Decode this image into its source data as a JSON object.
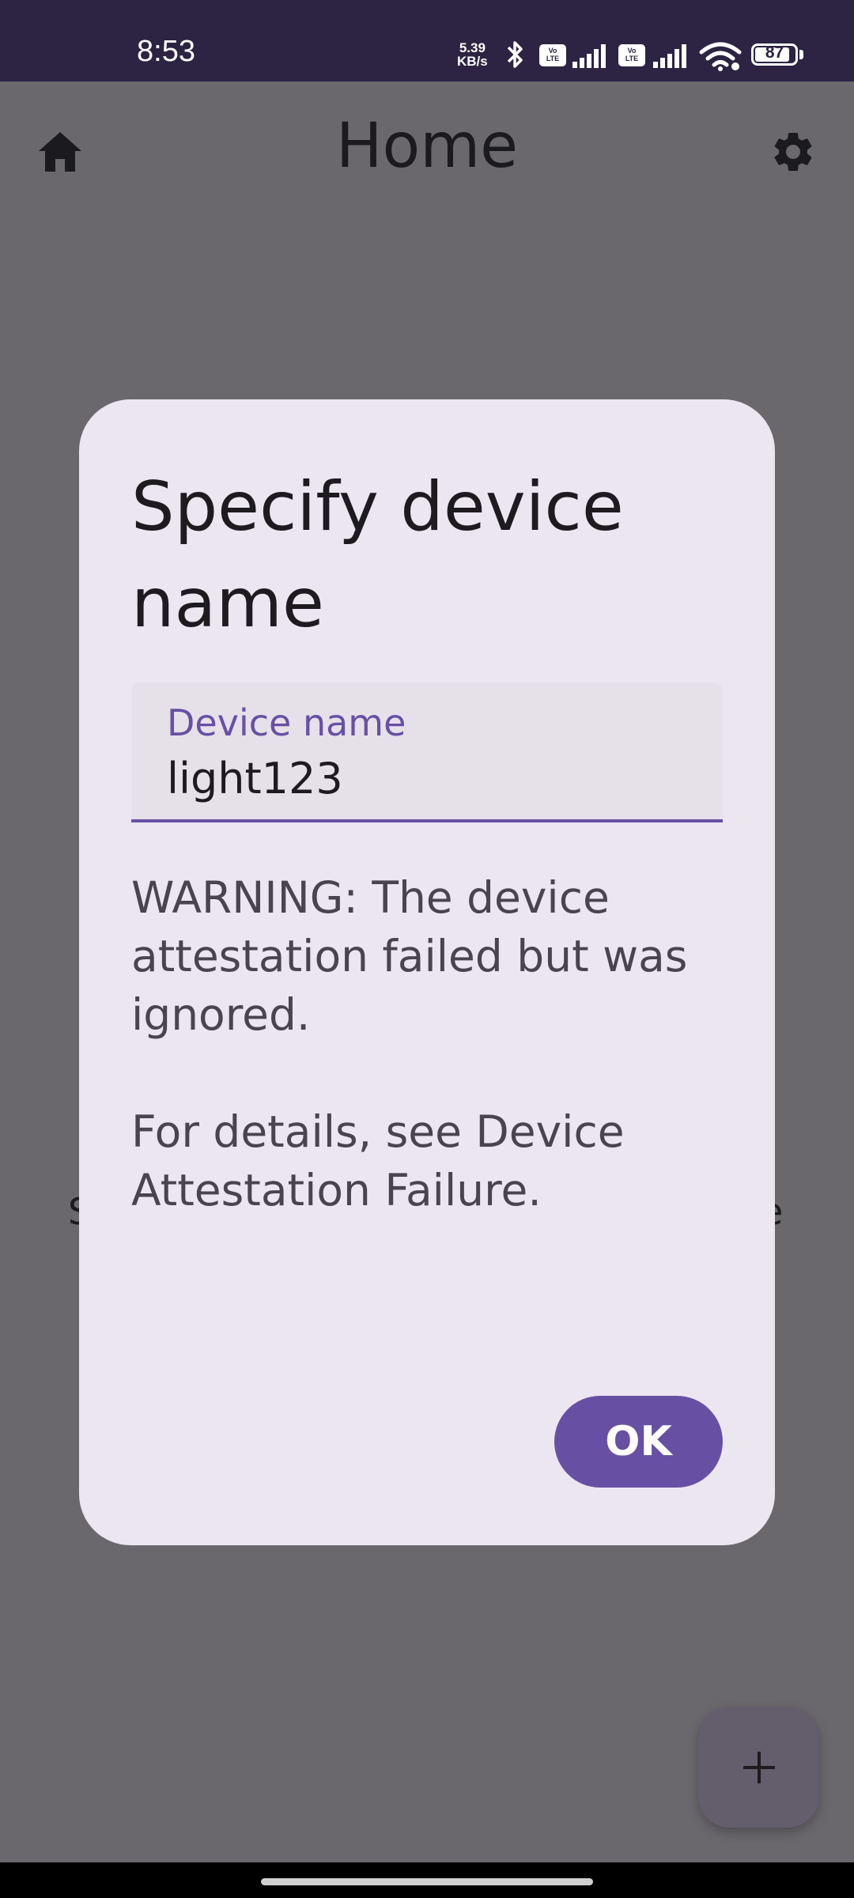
{
  "status_bar": {
    "time": "8:53",
    "net_speed_value": "5.39",
    "net_speed_unit": "KB/s",
    "battery_level": "87",
    "icons": [
      "bluetooth-icon",
      "volte-icon",
      "signal-icon",
      "volte-icon",
      "signal-icon",
      "wifi-icon",
      "battery-icon"
    ]
  },
  "app_bar": {
    "title": "Home",
    "left_icon": "home-icon",
    "right_icon": "settings-icon"
  },
  "background": {
    "partial_text_left": "S",
    "partial_text_right": "e"
  },
  "dialog": {
    "title": "Specify device name",
    "field_label": "Device name",
    "field_value": "light123",
    "warning_text": "WARNING: The device attestation failed but was ignored.",
    "details_text": "For details, see Device Attestation Failure.",
    "ok_label": "OK"
  },
  "fab": {
    "icon": "plus-icon"
  },
  "colors": {
    "primary": "#6750a4",
    "dialog_surface": "#ece6f0",
    "scrim": "#6a686d",
    "status_bar": "#2c2442"
  }
}
